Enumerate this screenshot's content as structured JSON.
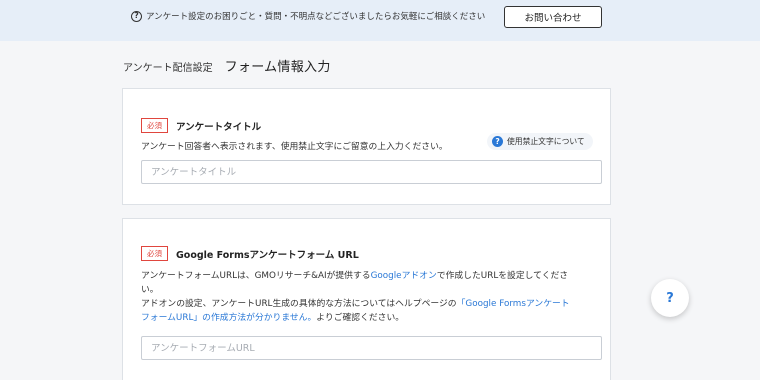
{
  "topbar": {
    "help_icon": "question-circle-icon",
    "help_text": "アンケート設定のお困りごと・質問・不明点などございましたらお気軽にご相談ください",
    "contact_label": "お問い合わせ"
  },
  "breadcrumb": {
    "parent": "アンケート配信設定",
    "title": "フォーム情報入力"
  },
  "survey_title_section": {
    "required_badge": "必須",
    "label": "アンケートタイトル",
    "description": "アンケート回答者へ表示されます、使用禁止文字にご留意の上入力ください。",
    "forbidden_chars_label": "使用禁止文字について",
    "input_value": "",
    "input_placeholder": "アンケートタイトル"
  },
  "form_url_section": {
    "required_badge": "必須",
    "label": "Google Formsアンケートフォーム URL",
    "desc_line1_part1": "アンケートフォームURLは、GMOリサーチ&AIが提供する",
    "desc_line1_link": "Googleアドオン",
    "desc_line1_part2": "で作成したURLを設定してくださ",
    "desc_line2": "い。",
    "desc_line3_part1": "アドオンの設定、アンケートURL生成の具体的な方法についてはヘルプページの",
    "desc_line3_link": "「Google Formsアンケート",
    "desc_line4_link": "フォームURL」の作成方法が分かりません。",
    "desc_line4_part2": "よりご確認ください。",
    "input_value": "",
    "input_placeholder": "アンケートフォームURL"
  },
  "help_fab": {
    "label": "?",
    "icon": "help-icon"
  },
  "colors": {
    "topbar_bg": "#e6eef8",
    "page_bg": "#f5f6f8",
    "required_red": "#e0463e",
    "link_blue": "#2a78d6"
  }
}
